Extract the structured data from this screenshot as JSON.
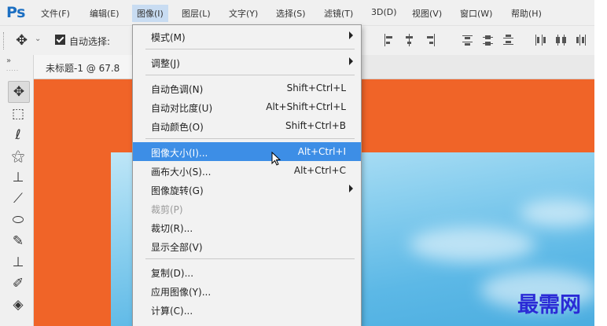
{
  "app": {
    "logo": "Ps"
  },
  "menubar": {
    "items": [
      "文件(F)",
      "编辑(E)",
      "图像(I)",
      "图层(L)",
      "文字(Y)",
      "选择(S)",
      "滤镜(T)",
      "3D(D)",
      "视图(V)",
      "窗口(W)",
      "帮助(H)"
    ],
    "active_index": 2
  },
  "options_bar": {
    "auto_select_label": "自动选择:",
    "auto_select_checked": true
  },
  "document": {
    "tab_title": "未标题-1 @ 67.8"
  },
  "image_menu": {
    "items": [
      {
        "label": "模式(M)",
        "shortcut": "",
        "submenu": true
      },
      {
        "separator": true
      },
      {
        "label": "调整(J)",
        "shortcut": "",
        "submenu": true
      },
      {
        "separator": true
      },
      {
        "label": "自动色调(N)",
        "shortcut": "Shift+Ctrl+L"
      },
      {
        "label": "自动对比度(U)",
        "shortcut": "Alt+Shift+Ctrl+L"
      },
      {
        "label": "自动颜色(O)",
        "shortcut": "Shift+Ctrl+B"
      },
      {
        "separator": true
      },
      {
        "label": "图像大小(I)...",
        "shortcut": "Alt+Ctrl+I",
        "highlighted": true
      },
      {
        "label": "画布大小(S)...",
        "shortcut": "Alt+Ctrl+C"
      },
      {
        "label": "图像旋转(G)",
        "shortcut": "",
        "submenu": true
      },
      {
        "label": "裁剪(P)",
        "shortcut": "",
        "disabled": true
      },
      {
        "label": "裁切(R)...",
        "shortcut": ""
      },
      {
        "label": "显示全部(V)",
        "shortcut": ""
      },
      {
        "separator": true
      },
      {
        "label": "复制(D)...",
        "shortcut": ""
      },
      {
        "label": "应用图像(Y)...",
        "shortcut": ""
      },
      {
        "label": "计算(C)...",
        "shortcut": ""
      }
    ]
  },
  "tools": [
    "move-tool",
    "marquee-tool",
    "lasso-tool",
    "magic-wand-tool",
    "crop-tool",
    "eyedropper-tool",
    "healing-brush-tool",
    "brush-tool",
    "clone-stamp-tool",
    "history-brush-tool",
    "eraser-tool"
  ],
  "watermark": {
    "text": "最需网"
  },
  "colors": {
    "canvas_orange": "#f06428",
    "menu_highlight": "#3d8ee6",
    "logo_blue": "#1c6fc2"
  }
}
